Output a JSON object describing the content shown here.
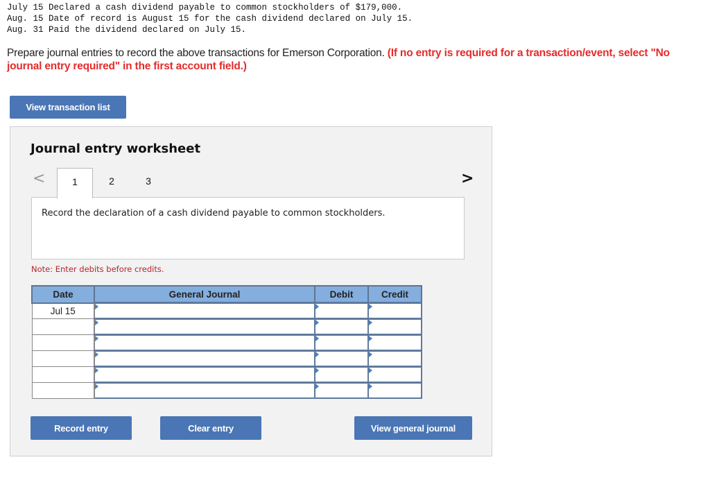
{
  "transactions": [
    "July 15 Declared a cash dividend payable to common stockholders of $179,000.",
    "Aug. 15 Date of record is August 15 for the cash dividend declared on July 15.",
    "Aug. 31 Paid the dividend declared on July 15."
  ],
  "instructions": {
    "main": "Prepare journal entries to record the above transactions for Emerson Corporation. ",
    "highlight": "(If no entry is required for a transaction/event, select \"No journal entry required\" in the first account field.)"
  },
  "buttons": {
    "view_transaction_list": "View transaction list",
    "record_entry": "Record entry",
    "clear_entry": "Clear entry",
    "view_general_journal": "View general journal"
  },
  "worksheet": {
    "title": "Journal entry worksheet",
    "prev_icon": "<",
    "next_icon": ">",
    "tabs": [
      "1",
      "2",
      "3"
    ],
    "active_tab": "1",
    "description": "Record the declaration of a cash dividend payable to common stockholders.",
    "note": "Note: Enter debits before credits."
  },
  "table": {
    "headers": {
      "date": "Date",
      "general_journal": "General Journal",
      "debit": "Debit",
      "credit": "Credit"
    },
    "rows": [
      {
        "date": "Jul 15",
        "account": "",
        "debit": "",
        "credit": ""
      },
      {
        "date": "",
        "account": "",
        "debit": "",
        "credit": ""
      },
      {
        "date": "",
        "account": "",
        "debit": "",
        "credit": ""
      },
      {
        "date": "",
        "account": "",
        "debit": "",
        "credit": ""
      },
      {
        "date": "",
        "account": "",
        "debit": "",
        "credit": ""
      },
      {
        "date": "",
        "account": "",
        "debit": "",
        "credit": ""
      }
    ]
  },
  "colors": {
    "button_blue": "#4a76b5",
    "header_blue": "#84aede",
    "alert_red": "#e52b2b",
    "note_red": "#b5262a"
  }
}
